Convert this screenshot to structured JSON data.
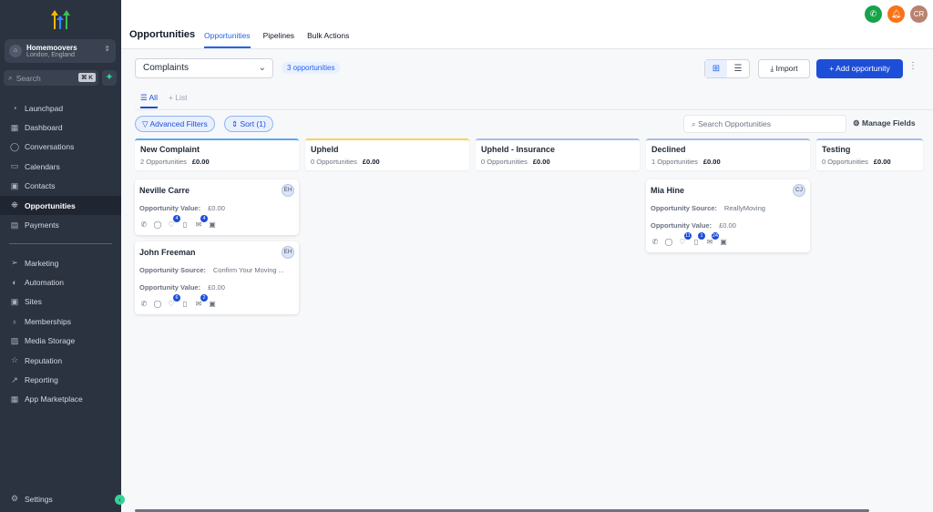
{
  "sidebar": {
    "account": {
      "name": "Homemoovers",
      "location": "London, England"
    },
    "search": {
      "placeholder": "Search",
      "shortcut": "⌘ K"
    },
    "items": [
      {
        "label": "Launchpad",
        "icon": "◔"
      },
      {
        "label": "Dashboard",
        "icon": "▦"
      },
      {
        "label": "Conversations",
        "icon": "◯"
      },
      {
        "label": "Calendars",
        "icon": "▭"
      },
      {
        "label": "Contacts",
        "icon": "▣"
      },
      {
        "label": "Opportunities",
        "icon": "⁜",
        "active": true
      },
      {
        "label": "Payments",
        "icon": "▤"
      }
    ],
    "items2": [
      {
        "label": "Marketing",
        "icon": "➢"
      },
      {
        "label": "Automation",
        "icon": "◐"
      },
      {
        "label": "Sites",
        "icon": "▣"
      },
      {
        "label": "Memberships",
        "icon": "♁"
      },
      {
        "label": "Media Storage",
        "icon": "▨"
      },
      {
        "label": "Reputation",
        "icon": "☆"
      },
      {
        "label": "Reporting",
        "icon": "↗"
      },
      {
        "label": "App Marketplace",
        "icon": "▦"
      }
    ],
    "settings": "Settings"
  },
  "header": {
    "title": "Opportunities",
    "tabs": [
      {
        "label": "Opportunities",
        "active": true
      },
      {
        "label": "Pipelines"
      },
      {
        "label": "Bulk Actions"
      }
    ],
    "user_initials": "CR",
    "colors": {
      "phone": "#16a34a",
      "bell": "#f97316",
      "avatar": "#b9826f"
    }
  },
  "toolbar": {
    "pipeline": "Complaints",
    "count": "3 opportunities",
    "import": "Import",
    "add": "Add opportunity"
  },
  "views": [
    {
      "label": "All",
      "active": true
    },
    {
      "label": "List"
    }
  ],
  "filters": {
    "advanced": "Advanced Filters",
    "sort": "Sort (1)",
    "search_placeholder": "Search Opportunities",
    "manage": "Manage Fields"
  },
  "columns": [
    {
      "title": "New Complaint",
      "count": "2 Opportunities",
      "value": "£0.00",
      "color": "#5aa9f0",
      "cards": [
        {
          "name": "Neville Carre",
          "owner": "EH",
          "fields": [
            {
              "label": "Opportunity Value:",
              "value": "£0.00"
            }
          ],
          "badges": {
            "tasks": "4",
            "appointments": "4"
          }
        },
        {
          "name": "John Freeman",
          "owner": "EH",
          "fields": [
            {
              "label": "Opportunity Source:",
              "value": "Confirm Your Moving ..."
            },
            {
              "label": "Opportunity Value:",
              "value": "£0.00"
            }
          ],
          "badges": {
            "tasks": "6",
            "appointments": "2"
          }
        }
      ]
    },
    {
      "title": "Upheld",
      "count": "0 Opportunities",
      "value": "£0.00",
      "color": "#f5d35a",
      "cards": []
    },
    {
      "title": "Upheld - Insurance",
      "count": "0 Opportunities",
      "value": "£0.00",
      "color": "#a8bde8",
      "cards": []
    },
    {
      "title": "Declined",
      "count": "1 Opportunities",
      "value": "£0.00",
      "color": "#a8bde8",
      "cards": [
        {
          "name": "Mia Hine",
          "owner": "CJ",
          "fields": [
            {
              "label": "Opportunity Source:",
              "value": "ReallyMoving"
            },
            {
              "label": "Opportunity Value:",
              "value": "£0.00"
            }
          ],
          "badges": {
            "tasks": "11",
            "notes": "1",
            "appointments": "24"
          }
        }
      ]
    },
    {
      "title": "Testing",
      "count": "0 Opportunities",
      "value": "£0.00",
      "color": "#a8bde8",
      "cards": []
    }
  ]
}
